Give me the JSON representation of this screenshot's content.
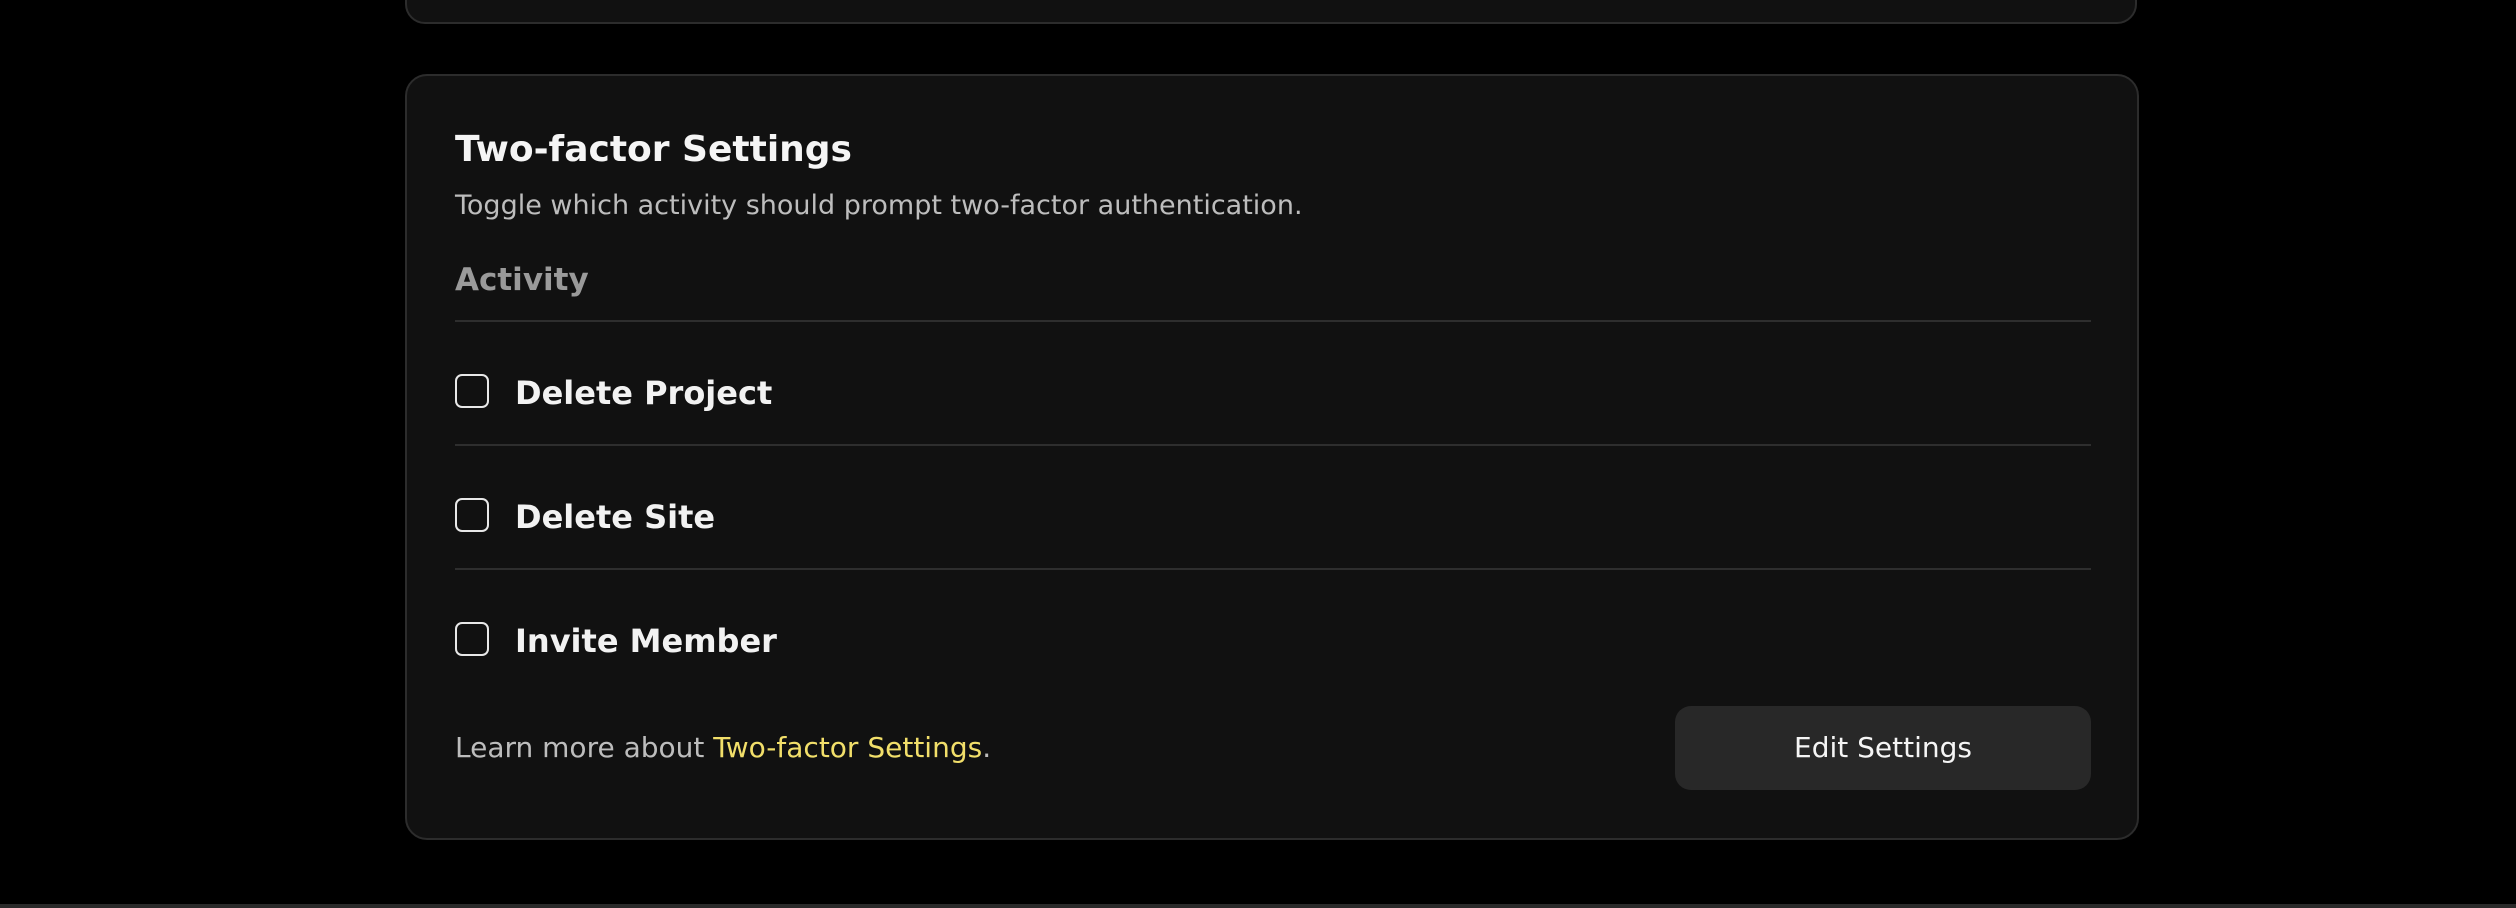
{
  "two_factor": {
    "title": "Two-factor Settings",
    "description": "Toggle which activity should prompt two-factor authentication.",
    "column_header": "Activity",
    "activities": [
      {
        "label": "Delete Project",
        "checked": false
      },
      {
        "label": "Delete Site",
        "checked": false
      },
      {
        "label": "Invite Member",
        "checked": false
      }
    ],
    "footer": {
      "learn_more_prefix": "Learn more about ",
      "learn_more_link": "Two-factor Settings",
      "learn_more_suffix": "."
    },
    "edit_button_label": "Edit Settings"
  },
  "colors": {
    "background": "#000000",
    "card": "#111111",
    "card_border": "#2c2c2c",
    "link_accent": "#f2df6a",
    "button_bg": "#282828"
  }
}
